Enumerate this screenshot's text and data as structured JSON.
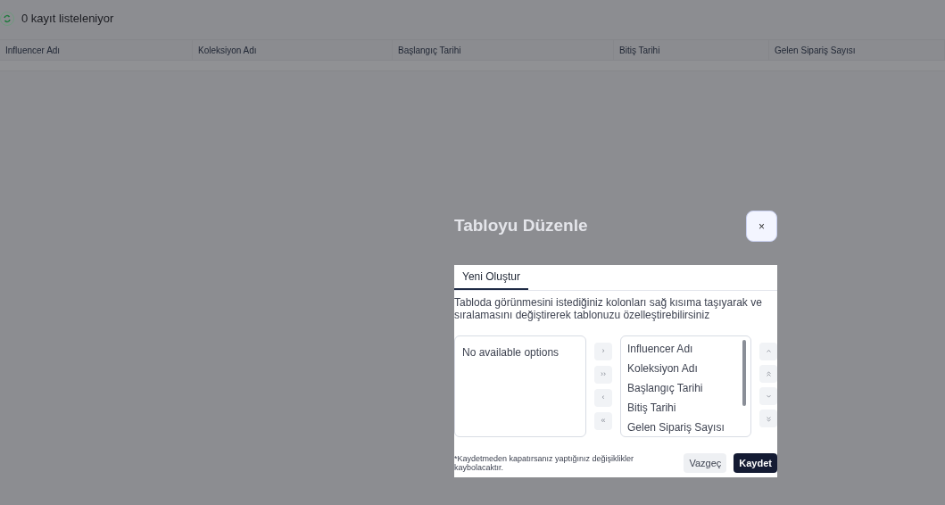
{
  "list_header": {
    "count_text": "0 kayıt listeleniyor"
  },
  "table": {
    "columns": [
      "Influencer Adı",
      "Koleksiyon Adı",
      "Başlangıç Tarihi",
      "Bitiş Tarihi",
      "Gelen Sipariş Sayısı"
    ]
  },
  "modal": {
    "title": "Tabloyu Düzenle",
    "close": "×",
    "tabs": [
      {
        "label": "Yeni Oluştur",
        "selected": true
      }
    ],
    "description": "Tabloda görünmesini istediğiniz kolonları sağ kısıma taşıyarak ve sıralamasını değiştirerek tablonuzu özelleştirebilirsiniz",
    "available_list": {
      "empty_text": "No available options"
    },
    "move_buttons": [
      "›",
      "››",
      "‹",
      "«"
    ],
    "selected_list": {
      "items": [
        "Influencer Adı",
        "Koleksiyon Adı",
        "Başlangıç Tarihi",
        "Bitiş Tarihi",
        "Gelen Sipariş Sayısı"
      ]
    },
    "note": "*Kaydetmeden kapatırsanız yaptığınız değişiklikler kaybolacaktır.",
    "buttons": [
      {
        "label": "Vazgeç",
        "kind": "secondary"
      },
      {
        "label": "Kaydet",
        "kind": "primary"
      }
    ]
  }
}
